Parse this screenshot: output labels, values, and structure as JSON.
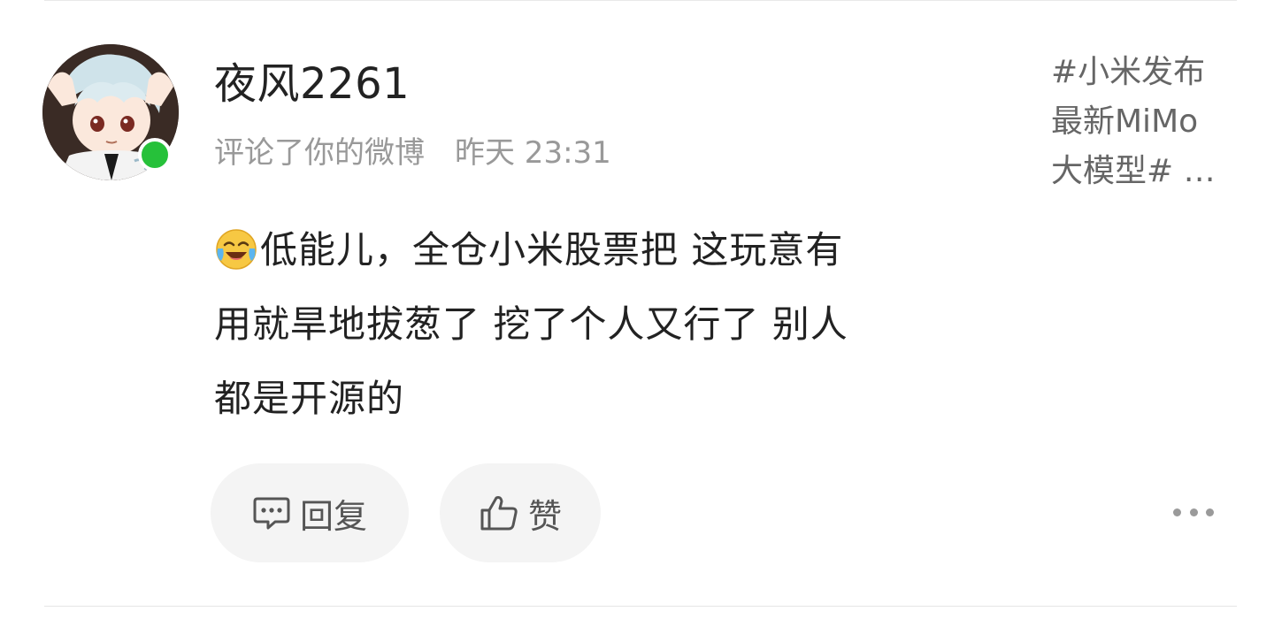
{
  "comment": {
    "username": "夜风2261",
    "action": "评论了你的微博",
    "time": "昨天 23:31",
    "emoji_icon": "laugh-cry-emoji-icon",
    "content_lines": [
      "低能儿，全仓小米股票把 这玩意有",
      "用就旱地拔葱了 挖了个人又行了 别人",
      "都是开源的"
    ]
  },
  "topic": {
    "lines": [
      "#小米发布",
      "最新MiMo",
      "大模型# …"
    ]
  },
  "actions": {
    "reply_label": "回复",
    "like_label": "赞"
  },
  "colors": {
    "online": "#26c13a",
    "pill_bg": "#f4f4f4",
    "meta_text": "#999999"
  }
}
